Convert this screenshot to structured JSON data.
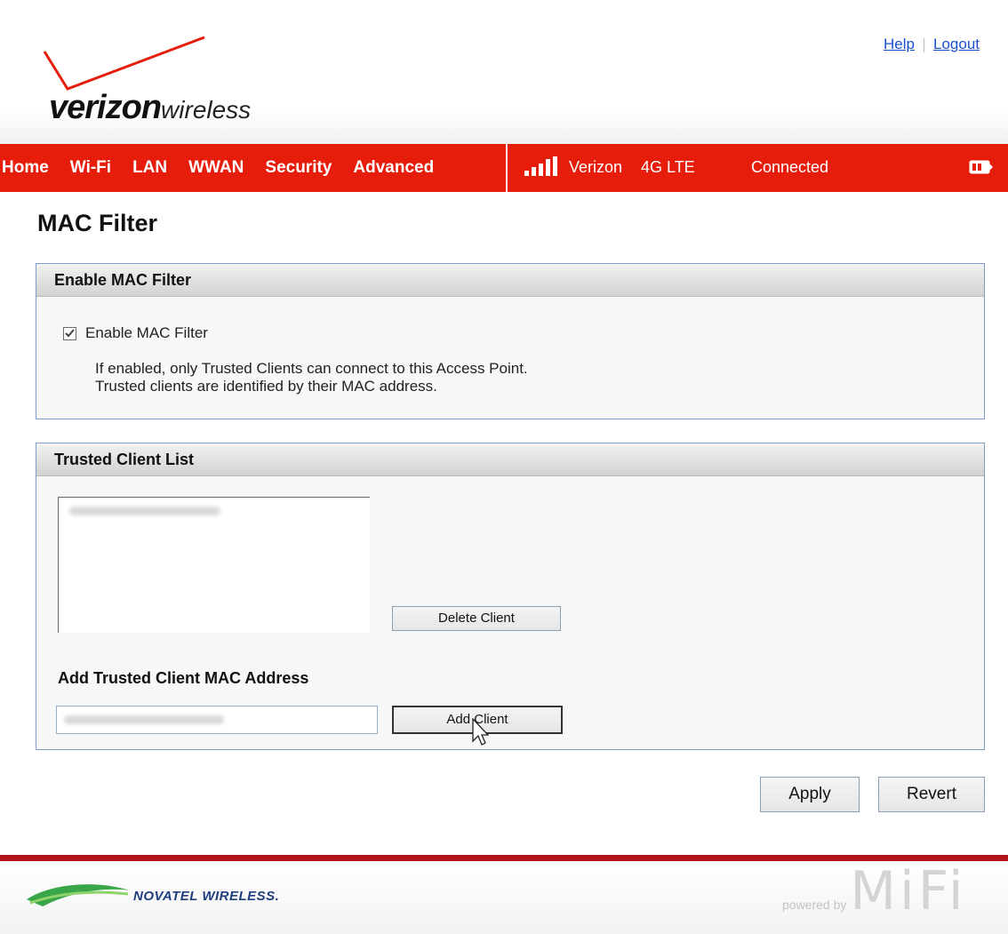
{
  "brand": {
    "logo_main": "verizon",
    "logo_sub": "wireless"
  },
  "top_links": {
    "help": "Help",
    "logout": "Logout"
  },
  "nav": {
    "items": [
      "Home",
      "Wi-Fi",
      "LAN",
      "WWAN",
      "Security",
      "Advanced"
    ]
  },
  "status": {
    "carrier": "Verizon",
    "network": "4G LTE",
    "connection": "Connected"
  },
  "page": {
    "title": "MAC Filter"
  },
  "enable_panel": {
    "title": "Enable MAC Filter",
    "checkbox_label": "Enable MAC Filter",
    "checked": true,
    "description_line1": "If enabled, only Trusted Clients can connect to this Access Point.",
    "description_line2": "Trusted clients are identified by their MAC address."
  },
  "trusted_panel": {
    "title": "Trusted Client List",
    "delete_button": "Delete Client",
    "add_label": "Add Trusted Client MAC Address",
    "add_button": "Add Client"
  },
  "actions": {
    "apply": "Apply",
    "revert": "Revert"
  },
  "footer": {
    "vendor": "NOVATEL WIRELESS.",
    "powered_by": "powered by",
    "product": "MiFi"
  },
  "colors": {
    "nav_red": "#e61d0b",
    "footer_red": "#b4131c",
    "link_blue": "#1a4fd1",
    "panel_border": "#7d9dc4"
  }
}
